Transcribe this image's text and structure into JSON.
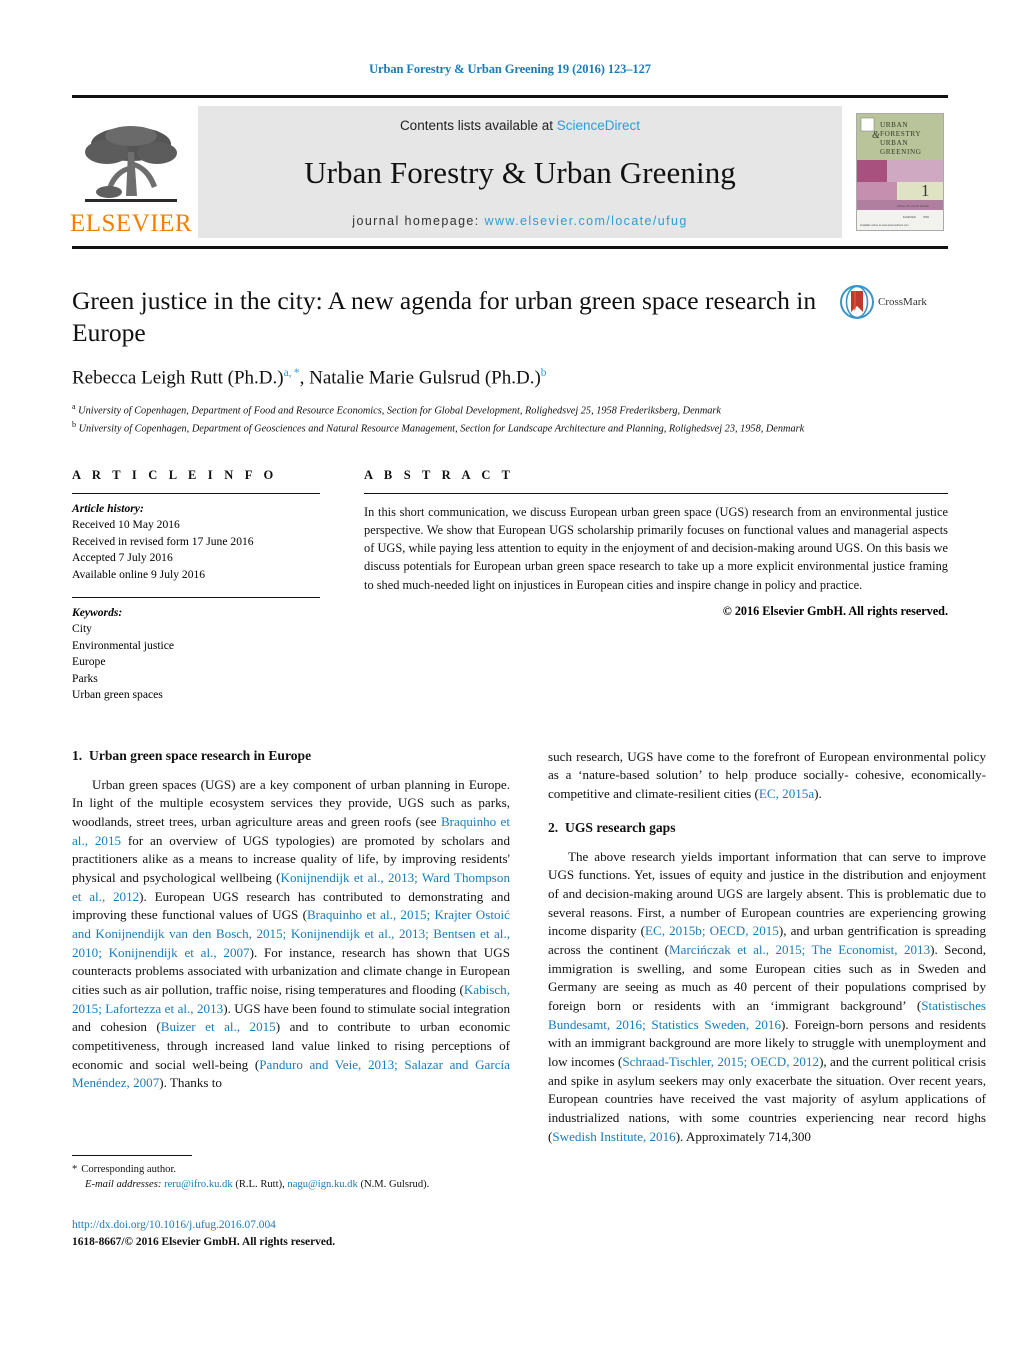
{
  "running_head": "Urban Forestry & Urban Greening 19 (2016) 123–127",
  "masthead": {
    "publisher_name": "ELSEVIER",
    "contents_prefix": "Contents lists available at ",
    "contents_link": "ScienceDirect",
    "journal_title": "Urban Forestry & Urban Greening",
    "homepage_prefix": "journal homepage: ",
    "homepage_url": "www.elsevier.com/locate/ufug",
    "cover": {
      "line1": "URBAN",
      "line2": "FORESTRY",
      "amp": "&",
      "line3": "URBAN",
      "line4": "GREENING",
      "issue_number": "1",
      "volume_note": "Volume 15 · Fourth Number"
    }
  },
  "article": {
    "title": "Green justice in the city: A new agenda for urban green space research in Europe",
    "crossmark_label": "CrossMark",
    "authors_html": "Rebecca Leigh Rutt (Ph.D.)<sup>a, *</sup>, Natalie Marie Gulsrud (Ph.D.)<sup>b</sup>",
    "affiliations": [
      {
        "marker": "a",
        "text": "University of Copenhagen, Department of Food and Resource Economics, Section for Global Development, Rolighedsvej 25, 1958 Frederiksberg, Denmark"
      },
      {
        "marker": "b",
        "text": "University of Copenhagen, Department of Geosciences and Natural Resource Management, Section for Landscape Architecture and Planning, Rolighedsvej 23, 1958, Denmark"
      }
    ]
  },
  "article_info": {
    "heading": "A R T I C L E   I N F O",
    "history_title": "Article history:",
    "history": [
      "Received 10 May 2016",
      "Received in revised form 17 June 2016",
      "Accepted 7 July 2016",
      "Available online 9 July 2016"
    ],
    "keywords_title": "Keywords:",
    "keywords": [
      "City",
      "Environmental justice",
      "Europe",
      "Parks",
      "Urban green spaces"
    ]
  },
  "abstract": {
    "heading": "A B S T R A C T",
    "text": "In this short communication, we discuss European urban green space (UGS) research from an environmental justice perspective. We show that European UGS scholarship primarily focuses on functional values and managerial aspects of UGS, while paying less attention to equity in the enjoyment of and decision-making around UGS. On this basis we discuss potentials for European urban green space research to take up a more explicit environmental justice framing to shed much-needed light on injustices in European cities and inspire change in policy and practice.",
    "copyright": "© 2016 Elsevier GmbH. All rights reserved."
  },
  "sections": {
    "s1": {
      "number": "1.",
      "title": "Urban green space research in Europe",
      "para1_html": "Urban green spaces (UGS) are a key component of urban planning in Europe. In light of the multiple ecosystem services they provide, UGS such as parks, woodlands, street trees, urban agriculture areas and green roofs (see <span class=\"ref\">Braquinho et al., 2015</span> for an overview of UGS typologies) are promoted by scholars and practitioners alike as a means to increase quality of life, by improving residents' physical and psychological wellbeing (<span class=\"ref\">Konijnendijk et al., 2013; Ward Thompson et al., 2012</span>). European UGS research has contributed to demonstrating and improving these functional values of UGS (<span class=\"ref\">Braquinho et al., 2015; Krajter Ostoi&cacute; and Konijnendijk van den Bosch, 2015; Konijnendijk et al., 2013; Bentsen et al., 2010; Konijnendijk et al., 2007</span>). For instance, research has shown that UGS counteracts problems associated with urbanization and climate change in European cities such as air pollution, traffic noise, rising temperatures and flooding (<span class=\"ref\">Kabisch, 2015; Lafortezza et al., 2013</span>). UGS have been found to stimulate social integration and cohesion (<span class=\"ref\">Buizer et al., 2015</span>) and to contribute to urban economic competitiveness, through increased land value linked to rising perceptions of economic and social well-being (<span class=\"ref\">Panduro and Veie, 2013; Salazar and García Menéndez, 2007</span>). Thanks to such research, UGS have come to the forefront of European environmental policy as a ‘nature-based solution’ to help produce socially- cohesive, economically-competitive and climate-resilient cities (<span class=\"ref\">EC, 2015a</span>)."
    },
    "s2": {
      "number": "2.",
      "title": "UGS research gaps",
      "para1_html": "The above research yields important information that can serve to improve UGS functions. Yet, issues of equity and justice in the distribution and enjoyment of and decision-making around UGS are largely absent. This is problematic due to several reasons. First, a number of European countries are experiencing growing income disparity (<span class=\"ref\">EC, 2015b; OECD, 2015</span>), and urban gentrification is spreading across the continent (<span class=\"ref\">Marcińczak et al., 2015; The Economist, 2013</span>). Second, immigration is swelling, and some European cities such as in Sweden and Germany are seeing as much as 40 percent of their populations comprised by foreign born or residents with an ‘immigrant background’ (<span class=\"ref\">Statistisches Bundesamt, 2016; Statistics Sweden, 2016</span>). Foreign-born persons and residents with an immigrant background are more likely to struggle with unemployment and low incomes (<span class=\"ref\">Schraad-Tischler, 2015; OECD, 2012</span>), and the current political crisis and spike in asylum seekers may only exacerbate the situation. Over recent years, European countries have received the vast majority of asylum applications of industrialized nations, with some countries experiencing near record highs (<span class=\"ref\">Swedish Institute, 2016</span>). Approximately 714,300"
    }
  },
  "footnote": {
    "star": "*",
    "corresponding": "Corresponding author.",
    "email_label": "E-mail addresses:",
    "email1": "reru@ifro.ku.dk",
    "email1_owner": "(R.L. Rutt)",
    "email2": "nagu@ign.ku.dk",
    "email2_owner": "(N.M. Gulsrud)."
  },
  "bottom": {
    "doi": "http://dx.doi.org/10.1016/j.ufug.2016.07.004",
    "issn_line": "1618-8667/© 2016 Elsevier GmbH. All rights reserved."
  },
  "colors": {
    "link_blue": "#1a7bb9",
    "sciencedirect_blue": "#2a9fd6",
    "elsevier_orange": "#F08000",
    "band_gray": "#e6e6e6"
  }
}
